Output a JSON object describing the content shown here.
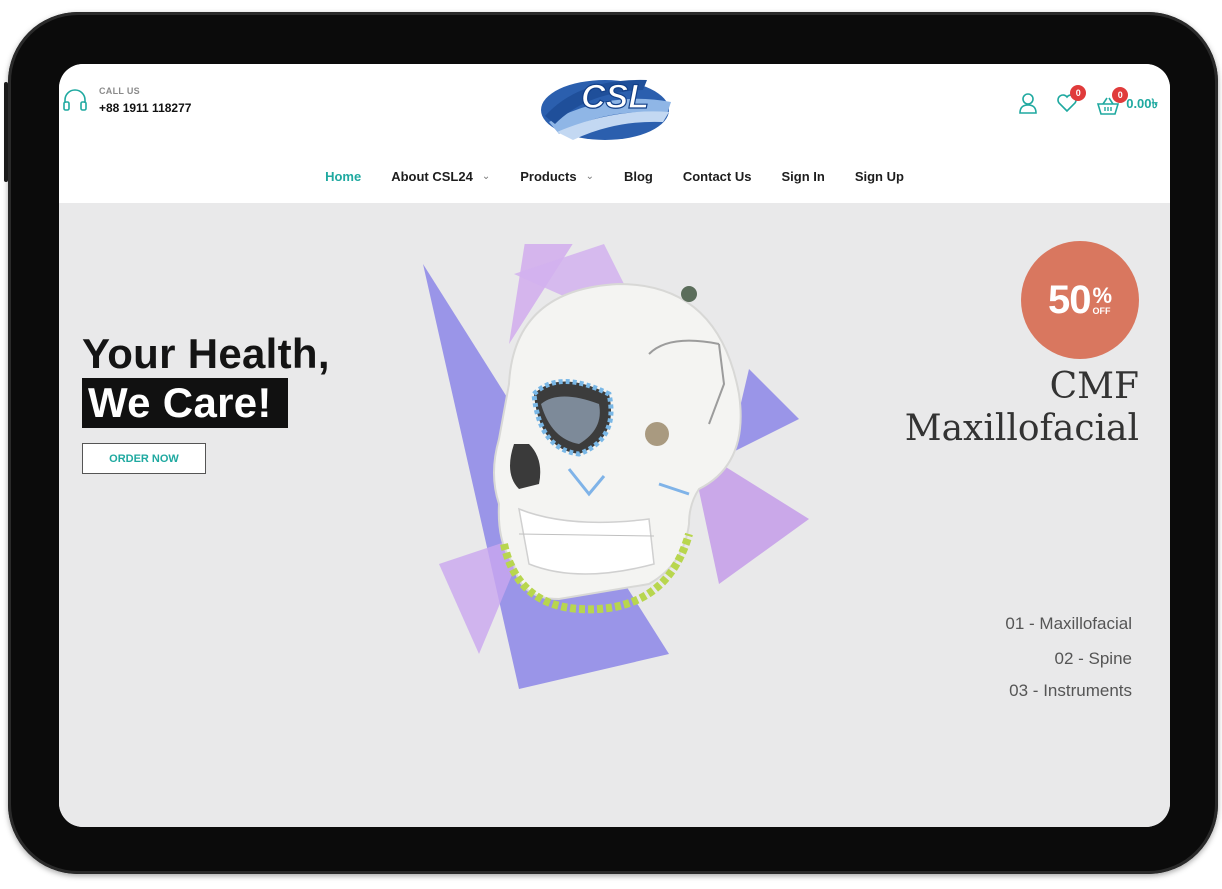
{
  "header": {
    "call_label": "CALL US",
    "phone": "+88 1911 118277",
    "logo_text": "CSL",
    "wishlist_count": "0",
    "cart_count": "0",
    "cart_total": "0.00৳"
  },
  "nav": {
    "items": [
      {
        "label": "Home",
        "active": true
      },
      {
        "label": "About CSL24",
        "dropdown": true
      },
      {
        "label": "Products",
        "dropdown": true
      },
      {
        "label": "Blog"
      },
      {
        "label": "Contact Us"
      },
      {
        "label": "Sign In"
      },
      {
        "label": "Sign Up"
      }
    ]
  },
  "hero": {
    "headline_line1": "Your Health,",
    "headline_line2": "We Care!",
    "cta": "ORDER NOW",
    "discount_value": "50",
    "discount_percent": "%",
    "discount_off": "OFF",
    "product_title_line1": "CMF",
    "product_title_line2": "Maxillofacial",
    "categories": [
      "01 - Maxillofacial",
      "02 - Spine",
      "03 - Instruments"
    ]
  },
  "colors": {
    "accent": "#1fa9a0",
    "badge": "#e03b3b",
    "discount_bg": "#d9775f",
    "hero_bg": "#e9e9ea"
  }
}
